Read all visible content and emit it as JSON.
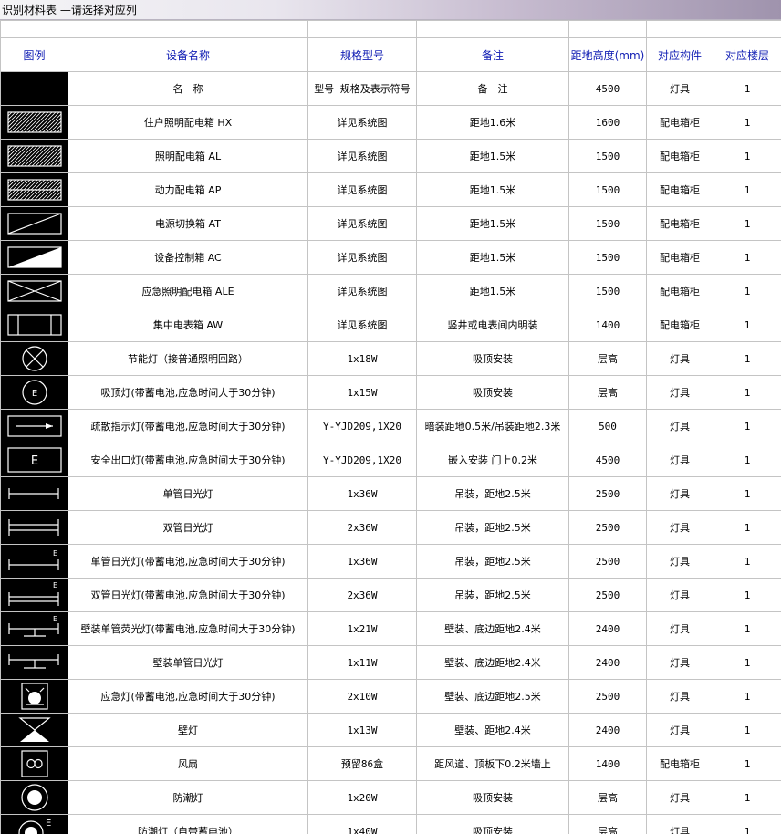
{
  "window": {
    "title": "识别材料表 —请选择对应列"
  },
  "colors": {
    "header_text": "#0e1bb3",
    "grid_line": "#c4c4c4",
    "legend_bg": "#000000"
  },
  "table": {
    "headers": [
      "图例",
      "设备名称",
      "规格型号",
      "备注",
      "距地高度(mm)",
      "对应构件",
      "对应楼层"
    ],
    "rows": [
      {
        "icon": "blank",
        "name": "名　称",
        "spec": "型号 规格及表示符号",
        "note": "备　注",
        "height": "4500",
        "component": "灯具",
        "floor": "1"
      },
      {
        "icon": "hatched-box-icon",
        "name": "住户照明配电箱 HX",
        "spec": "详见系统图",
        "note": "距地1.6米",
        "height": "1600",
        "component": "配电箱柜",
        "floor": "1"
      },
      {
        "icon": "hatched-box-icon",
        "name": "照明配电箱 AL",
        "spec": "详见系统图",
        "note": "距地1.5米",
        "height": "1500",
        "component": "配电箱柜",
        "floor": "1"
      },
      {
        "icon": "half-hatched-box-icon",
        "name": "动力配电箱 AP",
        "spec": "详见系统图",
        "note": "距地1.5米",
        "height": "1500",
        "component": "配电箱柜",
        "floor": "1"
      },
      {
        "icon": "diagonal-box-icon",
        "name": "电源切换箱 AT",
        "spec": "详见系统图",
        "note": "距地1.5米",
        "height": "1500",
        "component": "配电箱柜",
        "floor": "1"
      },
      {
        "icon": "half-filled-box-icon",
        "name": "设备控制箱 AC",
        "spec": "详见系统图",
        "note": "距地1.5米",
        "height": "1500",
        "component": "配电箱柜",
        "floor": "1"
      },
      {
        "icon": "cross-box-icon",
        "name": "应急照明配电箱 ALE",
        "spec": "详见系统图",
        "note": "距地1.5米",
        "height": "1500",
        "component": "配电箱柜",
        "floor": "1"
      },
      {
        "icon": "meter-box-icon",
        "name": "集中电表箱 AW",
        "spec": "详见系统图",
        "note": "竖井或电表间内明装",
        "height": "1400",
        "component": "配电箱柜",
        "floor": "1"
      },
      {
        "icon": "lamp-circle-x-icon",
        "name": "节能灯（接普通照明回路）",
        "spec": "1x18W",
        "note": "吸顶安装",
        "height": "层高",
        "component": "灯具",
        "floor": "1"
      },
      {
        "icon": "lamp-circle-e-icon",
        "name": "吸顶灯(带蓄电池,应急时间大于30分钟)",
        "spec": "1x15W",
        "note": "吸顶安装",
        "height": "层高",
        "component": "灯具",
        "floor": "1"
      },
      {
        "icon": "exit-arrow-box-icon",
        "name": "疏散指示灯(带蓄电池,应急时间大于30分钟)",
        "spec": "Y-YJD209,1X20",
        "note": "暗装距地0.5米/吊装距地2.3米",
        "height": "500",
        "component": "灯具",
        "floor": "1"
      },
      {
        "icon": "exit-e-box-icon",
        "name": "安全出口灯(带蓄电池,应急时间大于30分钟)",
        "spec": "Y-YJD209,1X20",
        "note": "嵌入安装 门上0.2米",
        "height": "4500",
        "component": "灯具",
        "floor": "1"
      },
      {
        "icon": "single-tube-icon",
        "name": "单管日光灯",
        "spec": "1x36W",
        "note": "吊装，距地2.5米",
        "height": "2500",
        "component": "灯具",
        "floor": "1"
      },
      {
        "icon": "double-tube-icon",
        "name": "双管日光灯",
        "spec": "2x36W",
        "note": "吊装，距地2.5米",
        "height": "2500",
        "component": "灯具",
        "floor": "1"
      },
      {
        "icon": "single-tube-e-icon",
        "name": "单管日光灯(带蓄电池,应急时间大于30分钟)",
        "spec": "1x36W",
        "note": "吊装，距地2.5米",
        "height": "2500",
        "component": "灯具",
        "floor": "1"
      },
      {
        "icon": "double-tube-e-icon",
        "name": "双管日光灯(带蓄电池,应急时间大于30分钟)",
        "spec": "2x36W",
        "note": "吊装，距地2.5米",
        "height": "2500",
        "component": "灯具",
        "floor": "1"
      },
      {
        "icon": "wall-tube-e-icon",
        "name": "壁装单管荧光灯(带蓄电池,应急时间大于30分钟)",
        "spec": "1x21W",
        "note": "壁装、底边距地2.4米",
        "height": "2400",
        "component": "灯具",
        "floor": "1"
      },
      {
        "icon": "wall-tube-icon",
        "name": "壁装单管日光灯",
        "spec": "1x11W",
        "note": "壁装、底边距地2.4米",
        "height": "2400",
        "component": "灯具",
        "floor": "1"
      },
      {
        "icon": "emergency-lamp-icon",
        "name": "应急灯(带蓄电池,应急时间大于30分钟)",
        "spec": "2x10W",
        "note": "壁装、底边距地2.5米",
        "height": "2500",
        "component": "灯具",
        "floor": "1"
      },
      {
        "icon": "wall-lamp-icon",
        "name": "壁灯",
        "spec": "1x13W",
        "note": "壁装、距地2.4米",
        "height": "2400",
        "component": "灯具",
        "floor": "1"
      },
      {
        "icon": "fan-icon",
        "name": "风扇",
        "spec": "预留86盒",
        "note": "距风道、顶板下0.2米墙上",
        "height": "1400",
        "component": "配电箱柜",
        "floor": "1"
      },
      {
        "icon": "moisture-lamp-icon",
        "name": "防潮灯",
        "spec": "1x20W",
        "note": "吸顶安装",
        "height": "层高",
        "component": "灯具",
        "floor": "1"
      },
      {
        "icon": "moisture-lamp-e-icon",
        "name": "防潮灯（自带蓄电池）",
        "spec": "1x40W",
        "note": "吸顶安装",
        "height": "层高",
        "component": "灯具",
        "floor": "1"
      }
    ]
  }
}
